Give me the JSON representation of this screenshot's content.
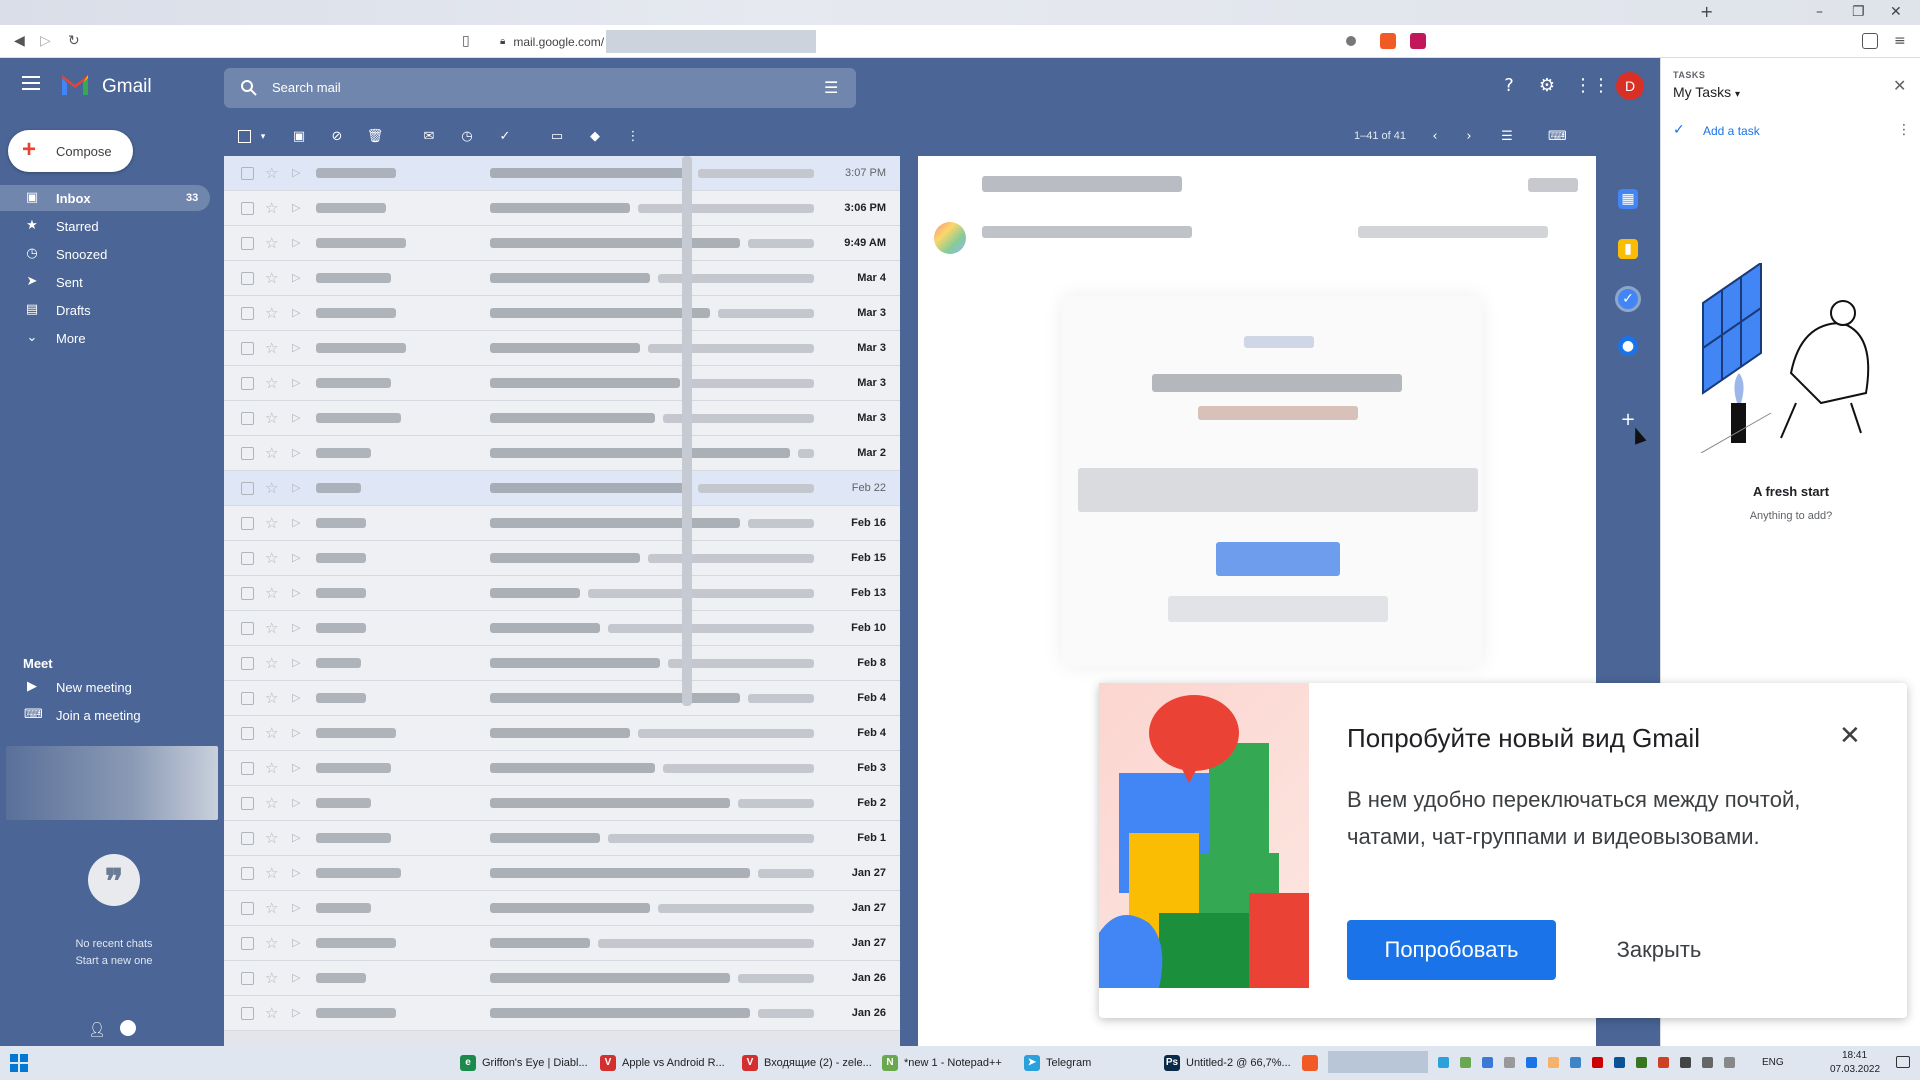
{
  "browser": {
    "url": "mail.google.com/",
    "controls": {
      "back": "◀",
      "forward": "▷",
      "reload": "↻",
      "new_tab": "+",
      "minimize": "–",
      "restore": "❐",
      "close": "✕"
    }
  },
  "gmail": {
    "title": "Gmail",
    "search_placeholder": "Search mail",
    "avatar_letter": "D",
    "compose_label": "Compose",
    "nav": [
      {
        "label": "Inbox",
        "count": "33",
        "icon": "inbox-icon"
      },
      {
        "label": "Starred",
        "count": "",
        "icon": "star-icon"
      },
      {
        "label": "Snoozed",
        "count": "",
        "icon": "clock-icon"
      },
      {
        "label": "Sent",
        "count": "",
        "icon": "send-icon"
      },
      {
        "label": "Drafts",
        "count": "",
        "icon": "draft-icon"
      },
      {
        "label": "More",
        "count": "",
        "icon": "chevron-down-icon"
      }
    ],
    "meet": {
      "title": "Meet",
      "new_meeting": "New meeting",
      "join_meeting": "Join a meeting"
    },
    "chat": {
      "no_recent": "No recent chats",
      "start_new": "Start a new one"
    },
    "pager": "1–41 of 41",
    "emails": [
      {
        "date": "3:07 PM",
        "bold": false,
        "selected": true
      },
      {
        "date": "3:06 PM",
        "bold": true
      },
      {
        "date": "9:49 AM",
        "bold": true
      },
      {
        "date": "Mar 4",
        "bold": true
      },
      {
        "date": "Mar 3",
        "bold": true
      },
      {
        "date": "Mar 3",
        "bold": true
      },
      {
        "date": "Mar 3",
        "bold": true
      },
      {
        "date": "Mar 3",
        "bold": true
      },
      {
        "date": "Mar 2",
        "bold": true
      },
      {
        "date": "Feb 22",
        "bold": false,
        "selected": true
      },
      {
        "date": "Feb 16",
        "bold": true
      },
      {
        "date": "Feb 15",
        "bold": true
      },
      {
        "date": "Feb 13",
        "bold": true
      },
      {
        "date": "Feb 10",
        "bold": true
      },
      {
        "date": "Feb 8",
        "bold": true
      },
      {
        "date": "Feb 4",
        "bold": true
      },
      {
        "date": "Feb 4",
        "bold": true
      },
      {
        "date": "Feb 3",
        "bold": true
      },
      {
        "date": "Feb 2",
        "bold": true
      },
      {
        "date": "Feb 1",
        "bold": true
      },
      {
        "date": "Jan 27",
        "bold": true
      },
      {
        "date": "Jan 27",
        "bold": true
      },
      {
        "date": "Jan 27",
        "bold": true
      },
      {
        "date": "Jan 26",
        "bold": true
      },
      {
        "date": "Jan 26",
        "bold": true
      }
    ]
  },
  "tasks": {
    "header": "TASKS",
    "list_name": "My Tasks",
    "add_task": "Add a task",
    "empty_title": "A fresh start",
    "empty_subtitle": "Anything to add?"
  },
  "promo": {
    "title": "Попробуйте новый вид Gmail",
    "body": "В нем удобно переключаться между почтой, чатами, чат-группами и видеовызовами.",
    "try_label": "Попробовать",
    "dismiss_label": "Закрыть"
  },
  "taskbar": {
    "apps": [
      {
        "label": "Griffon's Eye | Diabl...",
        "color": "#1b8a4a",
        "glyph": "e"
      },
      {
        "label": "Apple vs Android R...",
        "color": "#d32f2f",
        "glyph": "V"
      },
      {
        "label": "Входящие (2) - zele...",
        "color": "#d32f2f",
        "glyph": "V"
      },
      {
        "label": "*new 1 - Notepad++",
        "color": "#6aa84f",
        "glyph": "N"
      },
      {
        "label": "Telegram",
        "color": "#2aa1da",
        "glyph": "➤"
      },
      {
        "label": "Untitled-2 @ 66,7%...",
        "color": "#0a2a4a",
        "glyph": "Ps"
      }
    ],
    "lang": "ENG",
    "time": "18:41",
    "date": "07.03.2022"
  },
  "colors": {
    "theme_bg": "#4a6596",
    "accent": "#1a73e8",
    "avatar": "#d93025"
  }
}
